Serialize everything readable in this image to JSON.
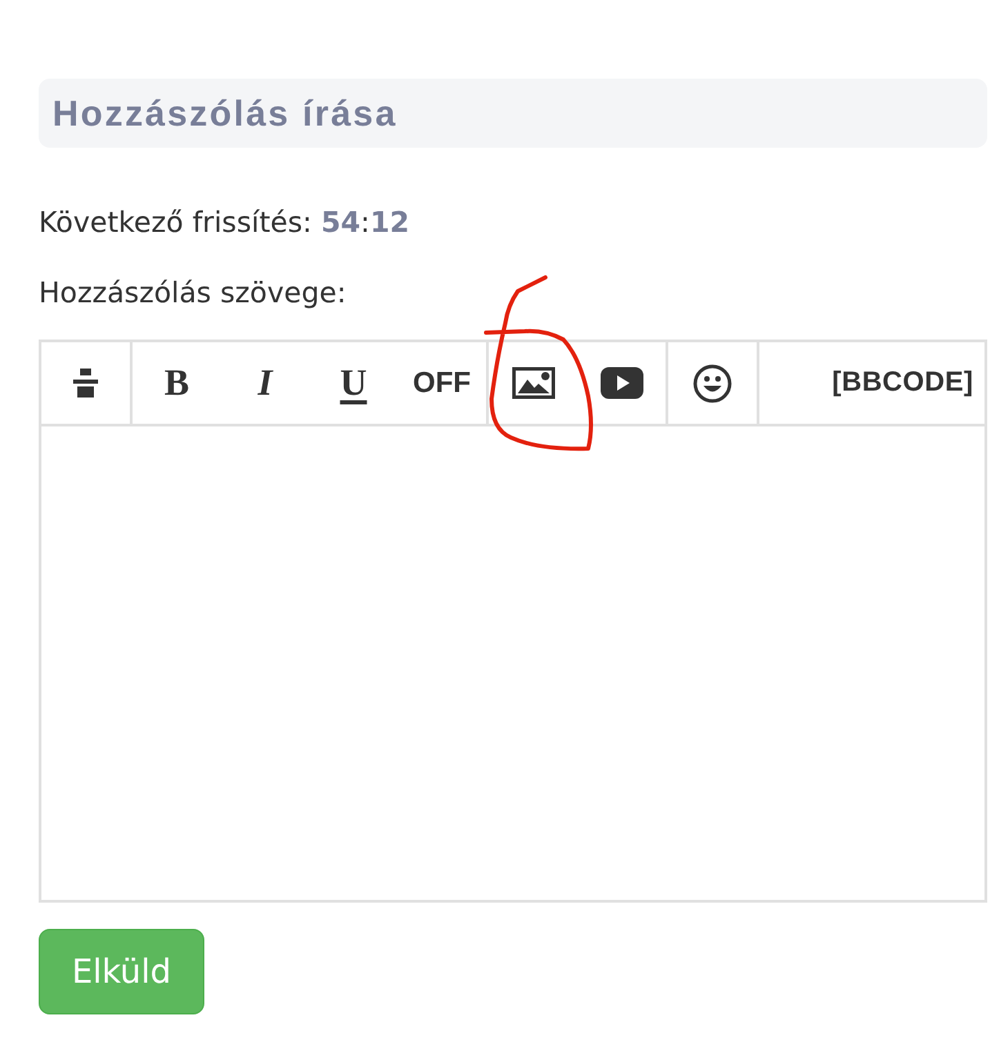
{
  "header": {
    "title": "Hozzászólás írása"
  },
  "refresh": {
    "label": "Következő frissítés:",
    "value": "**54**:**12**"
  },
  "editor": {
    "label": "Hozzászólás szövege:",
    "toolbar_groups": [
      [
        {
          "kind": "align",
          "circled": false
        }
      ],
      [
        {
          "kind": "bold",
          "label": "B",
          "circled": false
        },
        {
          "kind": "italic",
          "label": "I",
          "circled": false
        },
        {
          "kind": "underline",
          "label": "U",
          "circled": false
        },
        {
          "kind": "text",
          "label": "OFF",
          "circled": false
        }
      ],
      [
        {
          "kind": "image",
          "circled": true
        },
        {
          "kind": "video",
          "circled": false
        }
      ],
      [
        {
          "kind": "emoji",
          "circled": false
        }
      ],
      [
        {
          "kind": "mode",
          "label": "[BBCODE]",
          "circled": false
        }
      ]
    ]
  },
  "submit": {
    "label": "Elküld"
  }
}
